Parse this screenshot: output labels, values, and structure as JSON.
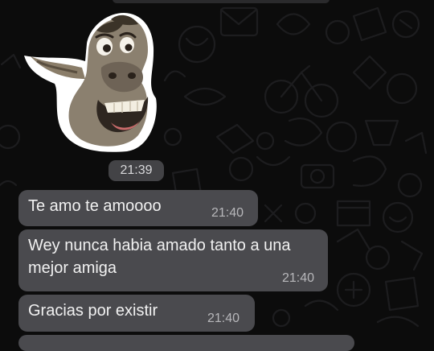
{
  "chat": {
    "sticker": {
      "icon": "donkey-sticker",
      "time": "21:39"
    },
    "messages": [
      {
        "text": "Te amo te amoooo",
        "time": "21:40"
      },
      {
        "text": "Wey nunca habia amado tanto a una mejor amiga",
        "time": "21:40"
      },
      {
        "text": "Gracias por existir",
        "time": "21:40"
      }
    ]
  },
  "colors": {
    "background": "#0c0c0c",
    "bubble": "#4a4a4e",
    "time_pill": "#434346",
    "text": "#f1f1f1",
    "timestamp": "#b7b7ba"
  }
}
